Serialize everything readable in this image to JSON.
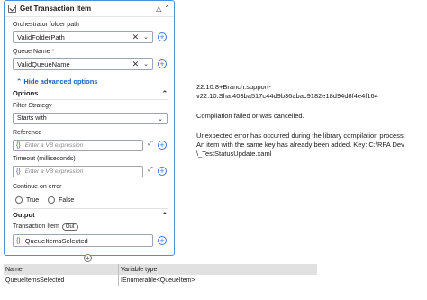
{
  "activity": {
    "title": "Get Transaction Item",
    "orchestrator_folder_path": {
      "label": "Orchestrator folder path",
      "value": "ValidFolderPath"
    },
    "queue_name": {
      "label": "Queue Name",
      "required_mark": "*",
      "value": "ValidQueueName"
    },
    "hide_advanced": "Hide advanced options",
    "options": {
      "header": "Options",
      "filter_strategy": {
        "label": "Filter Strategy",
        "value": "Starts with"
      },
      "reference": {
        "label": "Reference",
        "placeholder": "Enter a VB expression"
      },
      "timeout": {
        "label": "Timeout (milliseconds)",
        "placeholder": "Enter a VB expression"
      },
      "continue_on_error": {
        "label": "Continue on error",
        "true_label": "True",
        "false_label": "False"
      }
    },
    "output": {
      "header": "Output",
      "transaction_item": {
        "label": "Transaction Item",
        "badge": "Out",
        "value": "QueueItemsSelected"
      }
    }
  },
  "variables": {
    "headers": [
      "Name",
      "Variable type"
    ],
    "rows": [
      {
        "name": "QueueItemsSelected",
        "type": "IEnumerable<QueueItem>"
      }
    ]
  },
  "message": {
    "version_line1": "22.10.8+Branch.support-",
    "version_line2": "v22.10.Sha.403ba517c44d9b36abac9182e18d94d8f4e4f164",
    "compilation": "Compilation failed or was cancelled.",
    "error_line1": "Unexpected error has occurred during the library compilation process:",
    "error_line2": "An item with the same key has already been added. Key: C:\\RPA Dev",
    "error_line3": "\\_TestStatusUpdate.xaml"
  }
}
